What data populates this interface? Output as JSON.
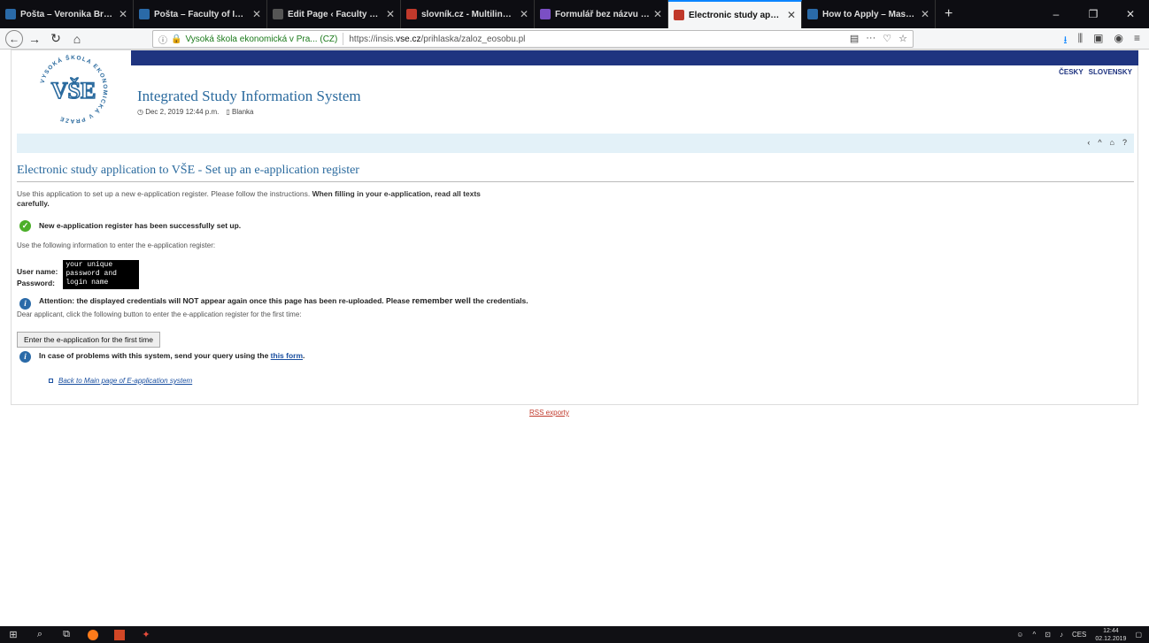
{
  "browser": {
    "tabs": [
      {
        "label": "Pošta – Veronika Brunerová – O",
        "color": "#2a6aa8"
      },
      {
        "label": "Pošta – Faculty of Informatics a",
        "color": "#2a6aa8"
      },
      {
        "label": "Edit Page ‹ Faculty of Informatics a",
        "color": "#555555"
      },
      {
        "label": "slovník.cz - Multilingual Diction",
        "color": "#c0392b"
      },
      {
        "label": "Formulář bez názvu - Formulář",
        "color": "#7b4fc4"
      },
      {
        "label": "Electronic study application to",
        "color": "#c0392b"
      },
      {
        "label": "How to Apply – Master in Man",
        "color": "#2a6aa8"
      }
    ],
    "new_tab": "+",
    "window_controls": {
      "minimize": "–",
      "maximize": "❐",
      "close": "✕"
    },
    "url_bar": {
      "info_icon": "ⓘ",
      "org": "Vysoká škola ekonomická v Pra... (CZ)",
      "url_prefix": "https://insis.",
      "url_domain": "vse.cz",
      "url_path": "/prihlaska/zaloz_eosobu.pl",
      "more": "···"
    }
  },
  "site": {
    "languages": [
      "ČESKY",
      "SLOVENSKY"
    ],
    "logo_text": "VŠE",
    "logo_ring": "VYSOKÁ ŠKOLA EKONOMICKÁ V PRAZE",
    "title": "Integrated Study Information System",
    "datetime": "Dec 2, 2019  12:44 p.m.",
    "user": "Blanka",
    "nav_icons": [
      "‹",
      "^",
      "⌂",
      "?"
    ]
  },
  "content": {
    "heading": "Electronic study application to VŠE - Set up an e-application register",
    "intro_normal": "Use this application to set up a new e-application register. Please follow the instructions. ",
    "intro_bold": "When filling in your e-application, read all texts carefully.",
    "success": "New e-application register has been successfully set up.",
    "use_info": "Use the following information to enter the e-application register:",
    "user_label": "User name:",
    "password_label": "Password:",
    "credentials_box": "your unique\npassword and\nlogin name",
    "attention_1": "Attention: the displayed credentials will NOT appear again once this page has been re-uploaded. Please ",
    "attention_strong": "remember well",
    "attention_2": " the credentials.",
    "dear": "Dear applicant, click the following button to enter the e-application register for the first time:",
    "button": "Enter the e-application for the first time",
    "problems_text": "In case of problems with this system, send your query using the ",
    "problems_link": "this form",
    "problems_end": ".",
    "back_link": "Back to Main page of E-application system"
  },
  "footer": {
    "rss": "RSS exporty"
  },
  "taskbar": {
    "lang": "CES",
    "time": "12:44",
    "date": "02.12.2019"
  }
}
